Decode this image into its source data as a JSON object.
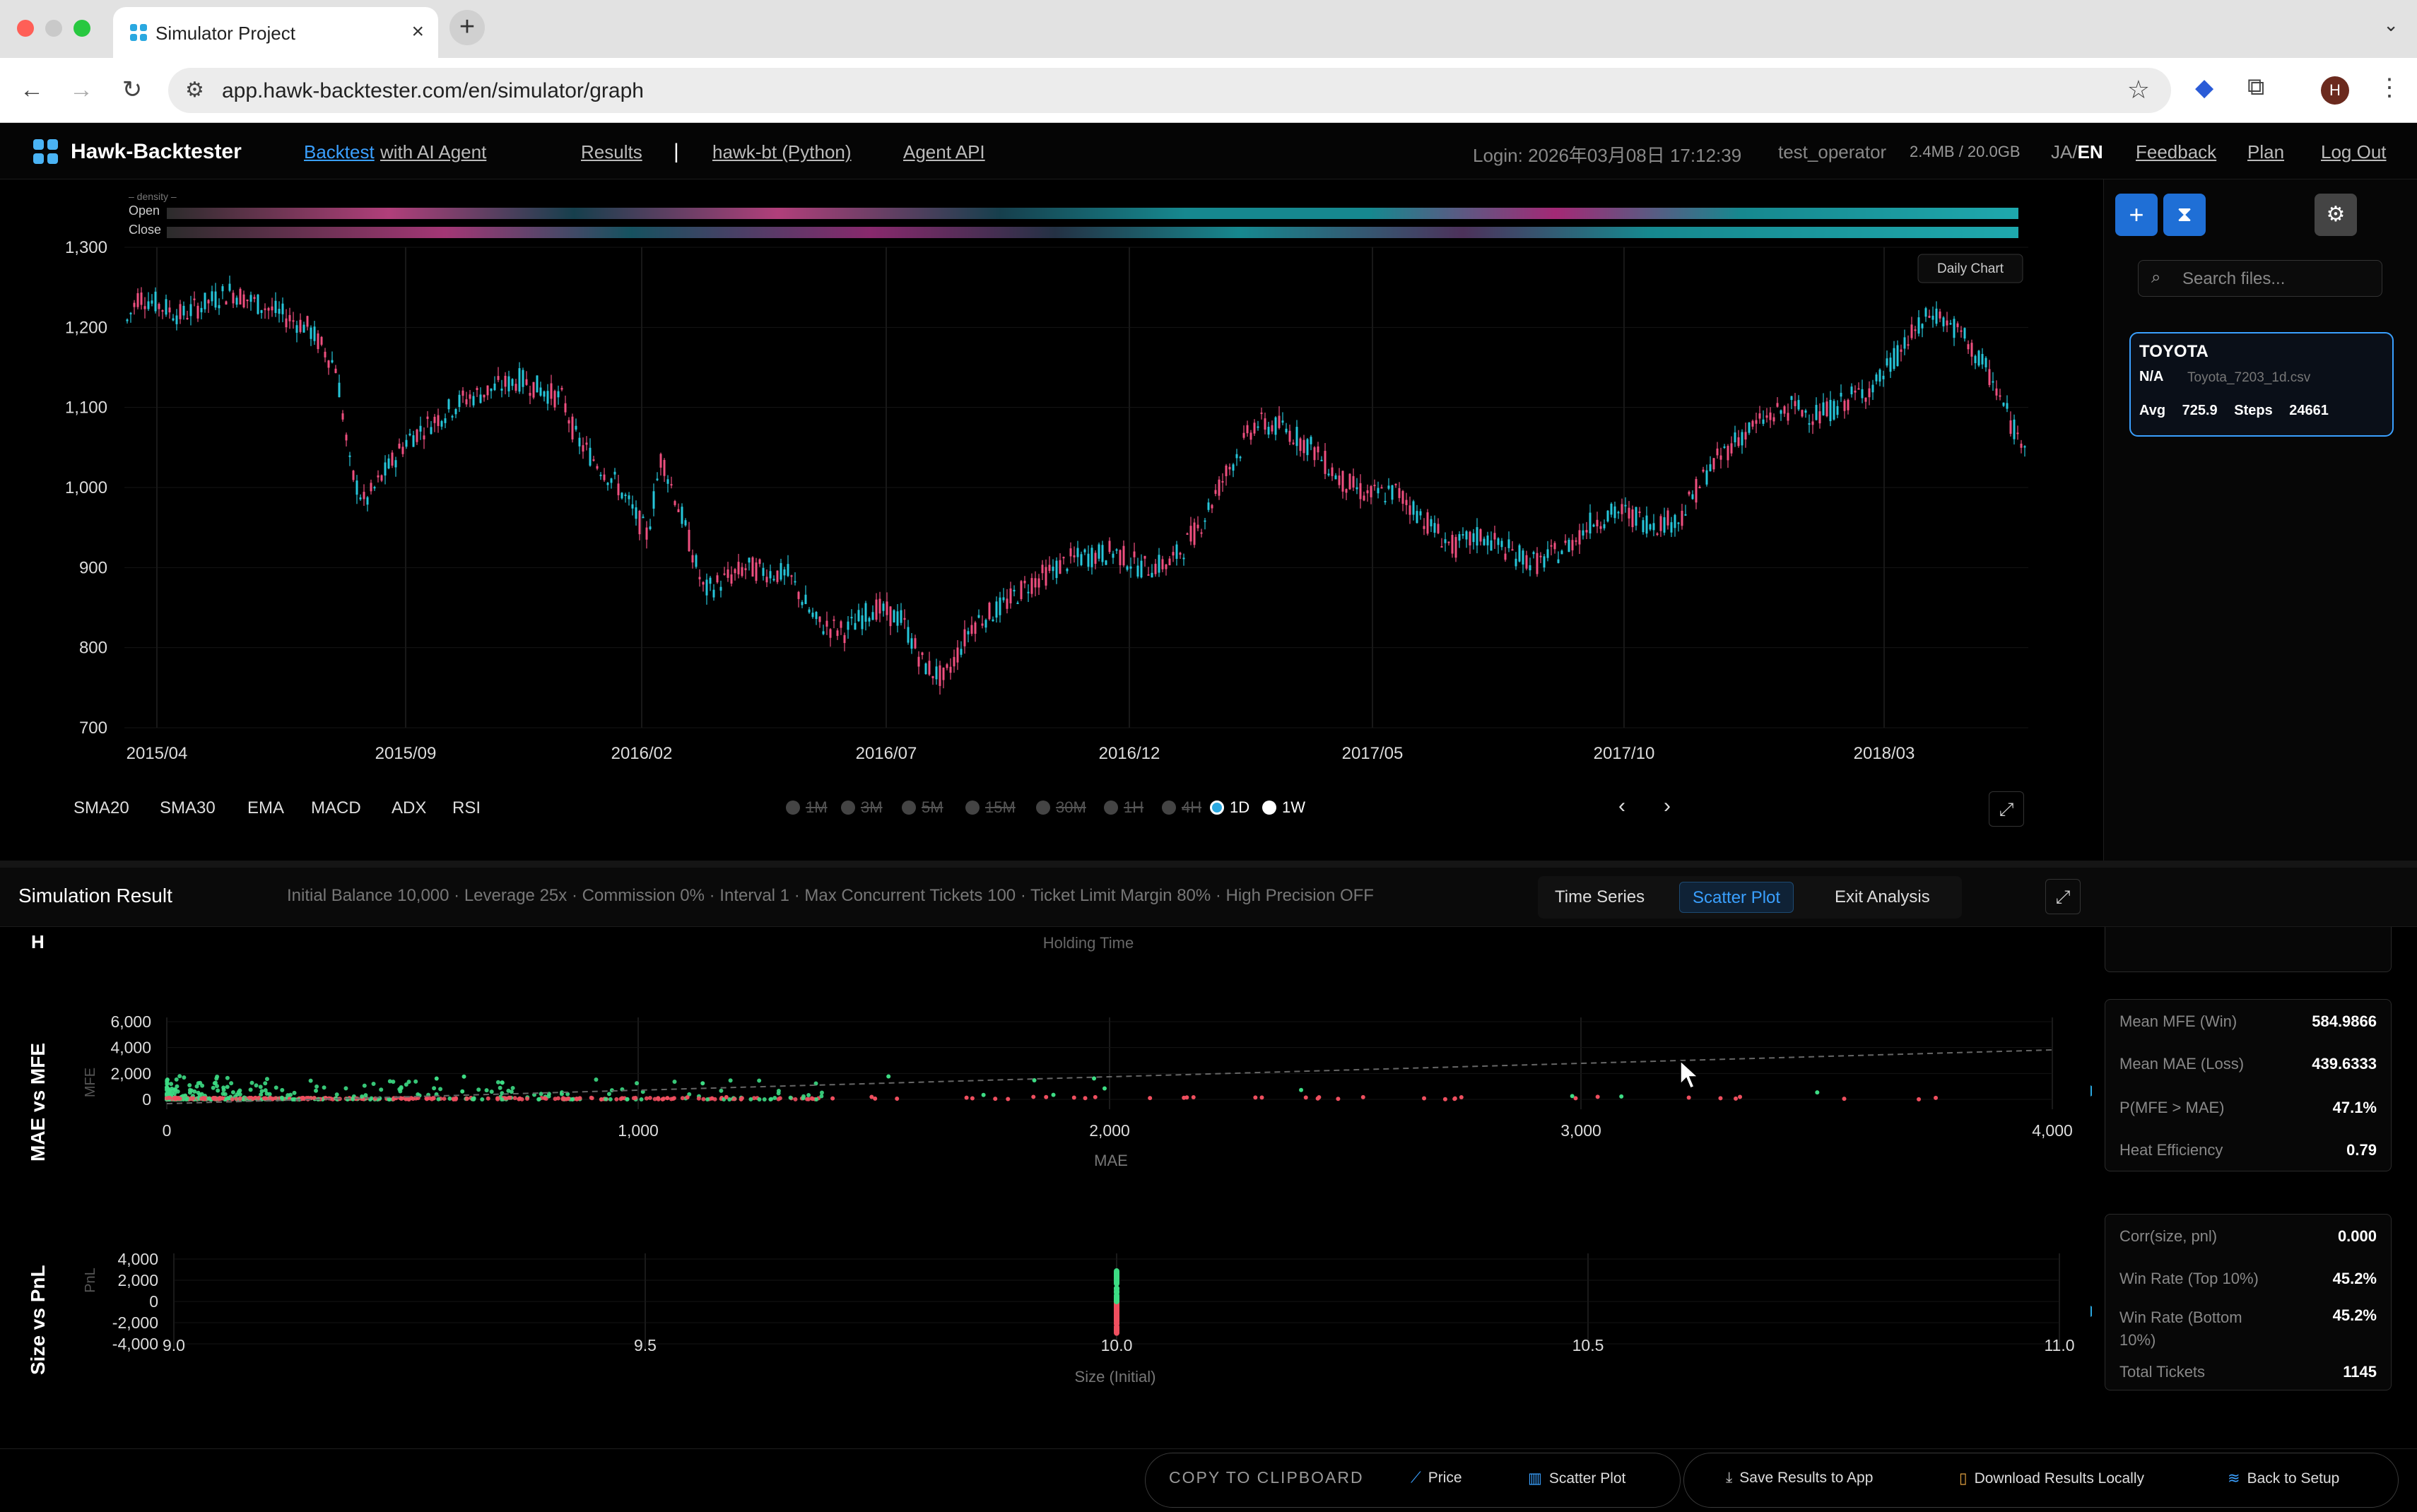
{
  "browser": {
    "tab_title": "Simulator Project",
    "url": "app.hawk-backtester.com/en/simulator/graph",
    "profile_initial": "H"
  },
  "header": {
    "brand": "Hawk-Backtester",
    "nav": [
      "Backtest",
      "with AI Agent",
      "Results"
    ],
    "nav_ext": [
      "hawk-bt (Python)",
      "Agent API"
    ],
    "separator": "|",
    "login": "Login: 2026年03月08日 17:12:39",
    "user": "test_operator",
    "storage": "2.4MB / 20.0GB",
    "lang_ja": "JA",
    "lang_sep": "/",
    "lang_en": "EN",
    "links": [
      "Feedback",
      "Plan",
      "Log Out"
    ]
  },
  "price_chart": {
    "density_label": "– density –",
    "open_label": "Open",
    "close_label": "Close",
    "daily_chart_label": "Daily Chart",
    "y_ticks": [
      "1,300",
      "1,200",
      "1,100",
      "1,000",
      "900",
      "800",
      "700"
    ],
    "x_ticks": [
      "2015/04",
      "2015/09",
      "2016/02",
      "2016/07",
      "2016/12",
      "2017/05",
      "2017/10",
      "2018/03"
    ],
    "indicators": [
      "SMA20",
      "SMA30",
      "EMA",
      "MACD",
      "ADX",
      "RSI"
    ],
    "timeframes": [
      "1M",
      "3M",
      "5M",
      "15M",
      "30M",
      "1H",
      "4H",
      "1D",
      "1W"
    ],
    "selected_timeframe": "1D",
    "colors": {
      "up": "#26c6da",
      "down": "#ef4f7f"
    }
  },
  "sidebar": {
    "search_placeholder": "Search files...",
    "file": {
      "name": "TOYOTA",
      "status": "N/A",
      "filename": "Toyota_7203_1d.csv",
      "avg_label": "Avg",
      "avg": "725.9",
      "steps_label": "Steps",
      "steps": "24661"
    }
  },
  "simulation": {
    "title": "Simulation Result",
    "params": "Initial Balance 10,000 · Leverage 25x · Commission 0% · Interval 1 · Max Concurrent Tickets 100 · Ticket Limit Margin 80% · High Precision OFF",
    "tabs": [
      "Time Series",
      "Scatter Plot",
      "Exit Analysis"
    ],
    "active_tab": "Scatter Plot",
    "top_label_h": "H",
    "top_cut_label": "Holding Time",
    "mae_mfe": {
      "section_label": "MAE vs MFE",
      "x_label": "MAE",
      "y_label": "MFE",
      "x_ticks": [
        "0",
        "1,000",
        "2,000",
        "3,000",
        "4,000"
      ],
      "y_ticks": [
        "6,000",
        "4,000",
        "2,000",
        "0"
      ]
    },
    "size_pnl": {
      "section_label": "Size vs PnL",
      "x_label": "Size (Initial)",
      "y_label": "PnL",
      "x_ticks": [
        "9.0",
        "9.5",
        "10.0",
        "10.5",
        "11.0"
      ],
      "y_ticks": [
        "4,000",
        "2,000",
        "0",
        "-2,000",
        "-4,000"
      ]
    },
    "stats1": [
      {
        "label": "Mean MFE (Win)",
        "value": "584.9866"
      },
      {
        "label": "Mean MAE (Loss)",
        "value": "439.6333"
      },
      {
        "label": "P(MFE > MAE)",
        "value": "47.1%"
      },
      {
        "label": "Heat Efficiency",
        "value": "0.79"
      }
    ],
    "stats2": [
      {
        "label": "Corr(size, pnl)",
        "value": "0.000"
      },
      {
        "label": "Win Rate (Top 10%)",
        "value": "45.2%"
      },
      {
        "label": "Win Rate (Bottom 10%)",
        "value": "45.2%"
      },
      {
        "label": "Total Tickets",
        "value": "1145"
      }
    ],
    "colors": {
      "win": "#3ddc84",
      "loss": "#ef4f5f"
    }
  },
  "footer": {
    "copy": "COPY TO CLIPBOARD",
    "price": "Price",
    "scatter": "Scatter Plot",
    "save": "Save Results to App",
    "download": "Download Results Locally",
    "back": "Back to Setup"
  }
}
